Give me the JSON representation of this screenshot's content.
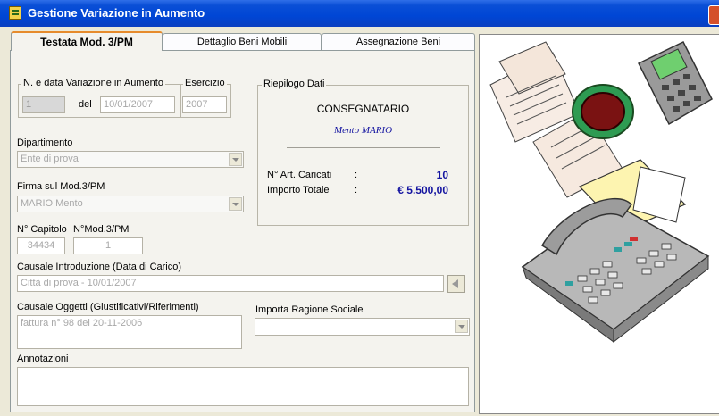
{
  "window": {
    "title": "Gestione Variazione in Aumento"
  },
  "tabs": [
    {
      "label": "Testata Mod. 3/PM"
    },
    {
      "label": "Dettaglio Beni Mobili"
    },
    {
      "label": "Assegnazione Beni"
    }
  ],
  "variazione": {
    "group_label": "N. e data Variazione in Aumento",
    "numero": "1",
    "del_label": "del",
    "data": "10/01/2007"
  },
  "esercizio": {
    "group_label": "Esercizio",
    "value": "2007"
  },
  "riepilogo": {
    "group_label": "Riepilogo Dati",
    "header": "CONSEGNATARIO",
    "name": "Mento MARIO",
    "art_label": "N° Art. Caricati",
    "colon": ":",
    "art_value": "10",
    "importo_label": "Importo Totale",
    "importo_value": "€ 5.500,00"
  },
  "dipartimento": {
    "label": "Dipartimento",
    "value": "Ente di prova"
  },
  "firma": {
    "label": "Firma sul Mod.3/PM",
    "value": "MARIO Mento"
  },
  "capitolo": {
    "label": "N° Capitolo",
    "value": "34434"
  },
  "mod3pm": {
    "label": "N°Mod.3/PM",
    "value": "1"
  },
  "causale_intro": {
    "label": "Causale Introduzione (Data di Carico)",
    "value": "Città di prova - 10/01/2007"
  },
  "causale_oggetti": {
    "label": "Causale Oggetti (Giustificativi/Riferimenti)",
    "value": "fattura n° 98 del 20-11-2006"
  },
  "ragione_sociale": {
    "label": "Importa Ragione Sociale",
    "value": ""
  },
  "annotazioni": {
    "label": "Annotazioni",
    "value": ""
  },
  "colors": {
    "title_bar": "#0046d5",
    "active_tab_border": "#e68b2c",
    "summary_values": "#1414a0"
  },
  "icons": {
    "app": "form-icon",
    "close": "close-icon",
    "dropdown": "chevron-down-icon",
    "import": "arrow-left-icon",
    "illustration": "office-clipart"
  }
}
